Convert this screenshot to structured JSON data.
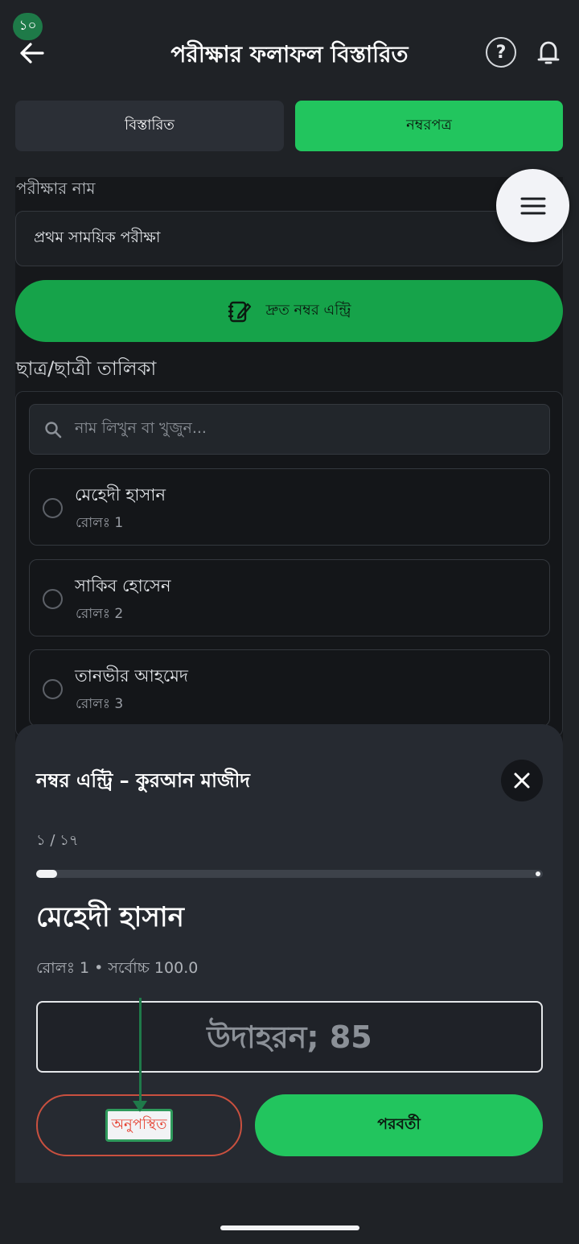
{
  "status": {
    "badge": "১০"
  },
  "header": {
    "title": "পরীক্ষার ফলাফল বিস্তারিত",
    "help_symbol": "?"
  },
  "tabs": [
    {
      "label": "বিস্তারিত",
      "active": false
    },
    {
      "label": "নম্বরপত্র",
      "active": true
    }
  ],
  "exam": {
    "label": "পরীক্ষার নাম",
    "selected": "প্রথম সাময়িক পরীক্ষা"
  },
  "quick_entry": {
    "label": "দ্রুত নম্বর এন্ট্রি"
  },
  "students_section": {
    "label": "ছাত্র/ছাত্রী তালিকা",
    "search_placeholder": "নাম লিখুন বা খুজুন...",
    "items": [
      {
        "name": "মেহেদী হাসান",
        "roll": "রোলঃ 1"
      },
      {
        "name": "সাকিব হোসেন",
        "roll": "রোলঃ 2"
      },
      {
        "name": "তানভীর আহমেদ",
        "roll": "রোলঃ 3"
      }
    ]
  },
  "sheet": {
    "title": "নম্বর এন্ট্রি – কুরআন মাজীদ",
    "counter": "১ / ১৭",
    "progress": 0.0588,
    "student_name": "মেহেদী হাসান",
    "roll_line": "রোলঃ 1  •  সর্বোচ্চ 100.0",
    "input_placeholder": "উদাহরন; 85",
    "absent_label": "অনুপস্থিত",
    "next_label": "পরবর্তী"
  },
  "colors": {
    "accent": "#22c55e",
    "absent": "#e53e2e",
    "background": "#1f2226"
  },
  "icons": [
    "back-arrow-icon",
    "help-icon",
    "bell-icon",
    "menu-icon",
    "edit-note-icon",
    "search-icon",
    "close-icon"
  ]
}
